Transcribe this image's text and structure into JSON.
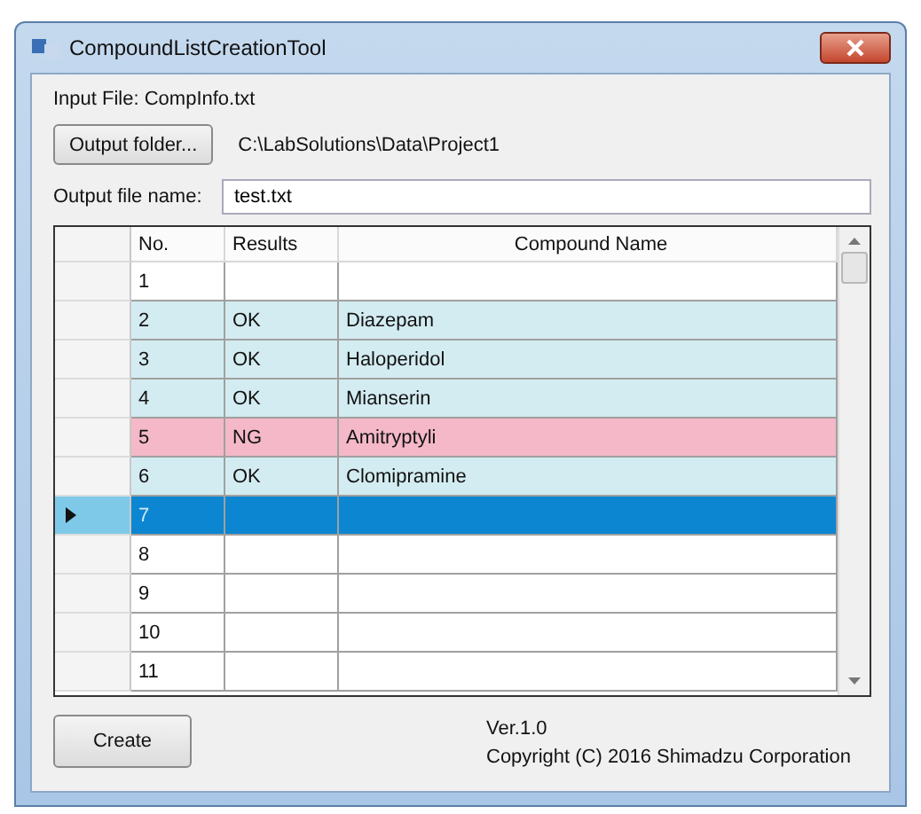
{
  "window": {
    "title": "CompoundListCreationTool"
  },
  "input_file_label": "Input File: CompInfo.txt",
  "output_folder": {
    "button": "Output folder...",
    "path": "C:\\LabSolutions\\Data\\Project1"
  },
  "output_file": {
    "label": "Output file name:",
    "value": "test.txt"
  },
  "table": {
    "columns": [
      "No.",
      "Results",
      "Compound Name"
    ],
    "rows": [
      {
        "no": "1",
        "result": "",
        "name": "",
        "kind": "empty",
        "selected": false
      },
      {
        "no": "2",
        "result": "OK",
        "name": "Diazepam",
        "kind": "ok",
        "selected": false
      },
      {
        "no": "3",
        "result": "OK",
        "name": "Haloperidol",
        "kind": "ok",
        "selected": false
      },
      {
        "no": "4",
        "result": "OK",
        "name": "Mianserin",
        "kind": "ok",
        "selected": false
      },
      {
        "no": "5",
        "result": "NG",
        "name": "Amitryptyli",
        "kind": "ng",
        "selected": false
      },
      {
        "no": "6",
        "result": "OK",
        "name": "Clomipramine",
        "kind": "ok",
        "selected": false
      },
      {
        "no": "7",
        "result": "",
        "name": "",
        "kind": "empty",
        "selected": true
      },
      {
        "no": "8",
        "result": "",
        "name": "",
        "kind": "empty",
        "selected": false
      },
      {
        "no": "9",
        "result": "",
        "name": "",
        "kind": "empty",
        "selected": false
      },
      {
        "no": "10",
        "result": "",
        "name": "",
        "kind": "empty",
        "selected": false
      },
      {
        "no": "11",
        "result": "",
        "name": "",
        "kind": "empty",
        "selected": false
      }
    ]
  },
  "create_button": "Create",
  "version": "Ver.1.0",
  "copyright": "Copyright (C) 2016 Shimadzu Corporation"
}
